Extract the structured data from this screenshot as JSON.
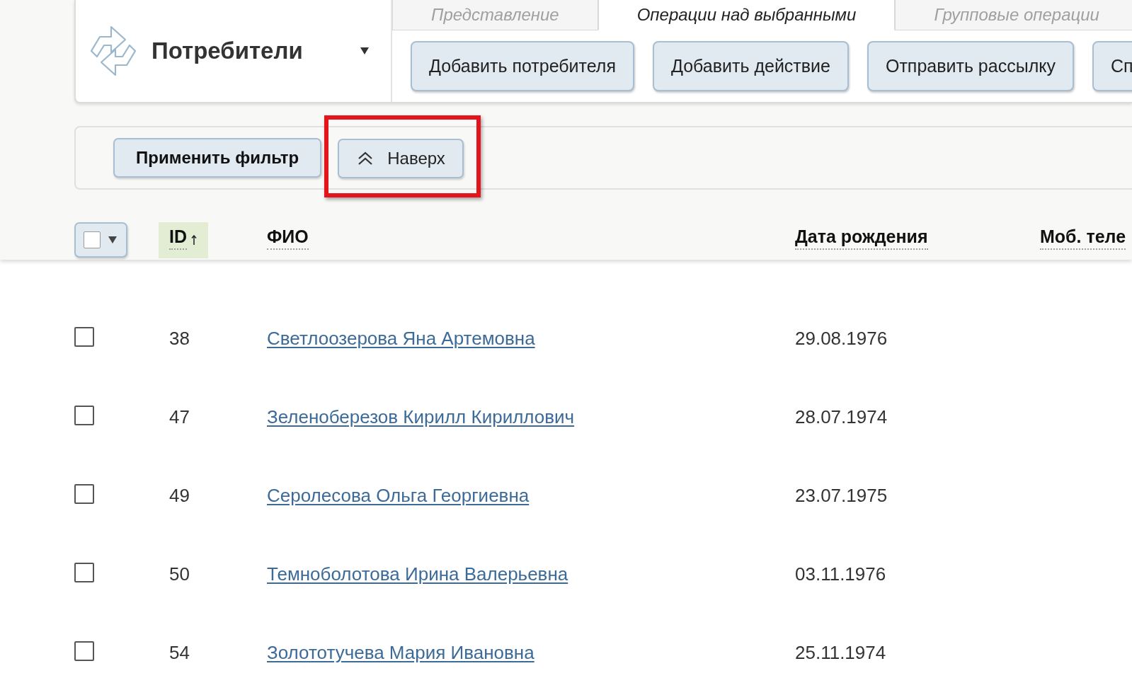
{
  "header": {
    "title": "Потребители"
  },
  "tabs": [
    {
      "label": "Представление",
      "selected": false
    },
    {
      "label": "Операции над выбранными",
      "selected": true
    },
    {
      "label": "Групповые операции",
      "selected": false
    }
  ],
  "actions": [
    "Добавить потребителя",
    "Добавить действие",
    "Отправить рассылку",
    "Сп"
  ],
  "filter_bar": {
    "buttons": [
      {
        "kind": "apply",
        "label": "Применить фильтр",
        "highlighted": false
      },
      {
        "kind": "scroll_top",
        "label": "Наверх",
        "highlighted": true
      }
    ]
  },
  "table": {
    "select_all": {
      "checked": false
    },
    "columns": [
      {
        "label": "ID",
        "sorted": true
      },
      {
        "label": "ФИО",
        "sorted": false
      },
      {
        "label": "Дата рождения",
        "sorted": false
      },
      {
        "label": "Моб. теле",
        "sorted": false
      }
    ],
    "rows": [
      {
        "id": "38",
        "name": "Светлоозерова Яна Артемовна",
        "birth_date": "29.08.1976",
        "checked": false
      },
      {
        "id": "47",
        "name": "Зеленоберезов Кирилл Кириллович",
        "birth_date": "28.07.1974",
        "checked": false
      },
      {
        "id": "49",
        "name": "Серолесова Ольга Георгиевна",
        "birth_date": "23.07.1975",
        "checked": false
      },
      {
        "id": "50",
        "name": "Темноболотова Ирина Валерьевна",
        "birth_date": "03.11.1976",
        "checked": false
      },
      {
        "id": "54",
        "name": "Золототучева Мария Ивановна",
        "birth_date": "25.11.1974",
        "checked": false
      }
    ]
  }
}
